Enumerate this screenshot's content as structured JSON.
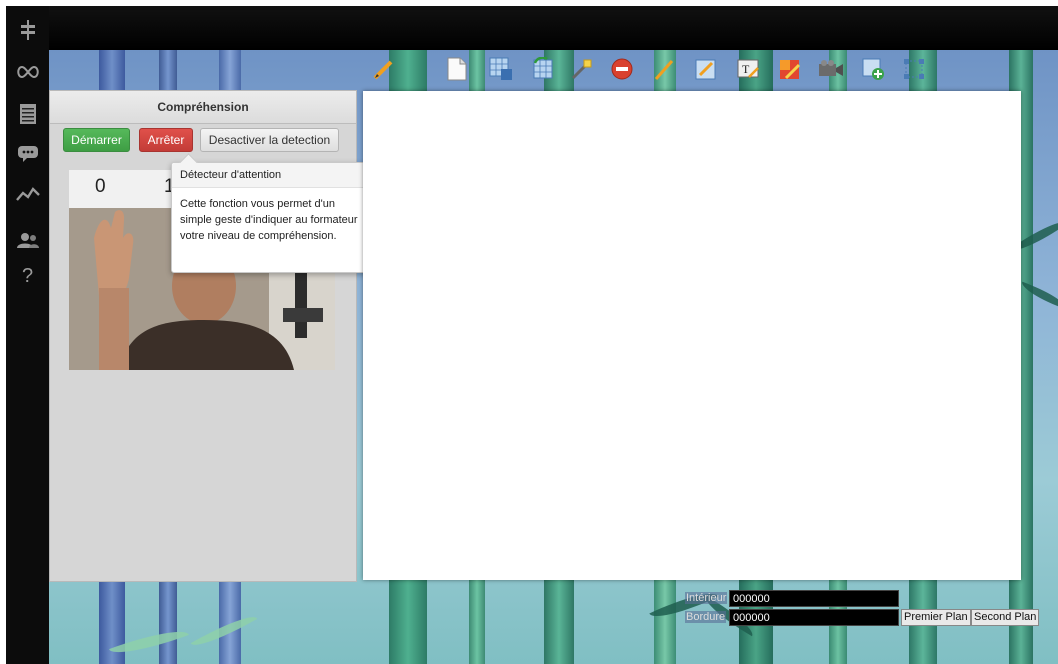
{
  "sidebar": {
    "icons": [
      "signpost-icon",
      "infinity-icon",
      "list-icon",
      "chat-icon",
      "activity-chart-icon",
      "users-icon",
      "help-icon"
    ],
    "help_glyph": "?"
  },
  "toolbar": {
    "icons": [
      "pencil-icon",
      "page-icon",
      "grid-save-icon",
      "grid-rotate-icon",
      "magic-wand-icon",
      "stop-icon",
      "line-icon",
      "edit-box-icon",
      "text-icon",
      "draw-icon",
      "camera-icon",
      "add-image-icon",
      "selection-icon"
    ]
  },
  "panel": {
    "title": "Compréhension",
    "start_label": "Démarrer",
    "stop_label": "Arrêter",
    "detection_label": "Desactiver la detection",
    "count_left": "0",
    "count_right": "1"
  },
  "tooltip": {
    "title": "Détecteur d'attention",
    "body": "Cette fonction vous permet d'un simple geste d'indiquer au formateur votre niveau de compréhension."
  },
  "colors": {
    "interior_label": "Intérieur",
    "interior_value": "000000",
    "border_label": "Bordure",
    "border_value": "000000",
    "foreground_button": "Premier Plan",
    "background_button": "Second Plan"
  },
  "theme": {
    "start_green": "#4cae4f",
    "stop_red": "#d9534f",
    "sky_blue": "#8fb4d7",
    "bamboo_green": "#2f7d66"
  }
}
